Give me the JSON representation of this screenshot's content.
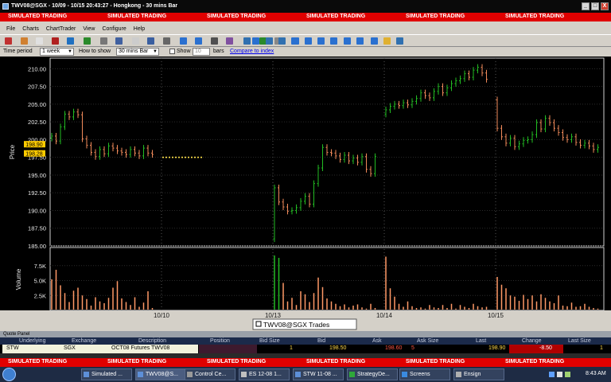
{
  "window": {
    "title": "TWV08@SGX - 10/09 - 10/15 20:43:27 - Hongkong - 30 mins Bar",
    "buttons": [
      "_",
      "□",
      "X"
    ]
  },
  "simulated_banner": "SIMULATED TRADING",
  "menu": [
    "File",
    "Charts",
    "ChartTrader",
    "View",
    "Configure",
    "Help"
  ],
  "options": {
    "time_period_label": "Time period",
    "time_period_value": "1 week",
    "how_to_show_label": "How to show",
    "how_to_show_value": "30 mins Bar",
    "show_label": "Show",
    "show_value": "10",
    "bars_label": "bars",
    "compare_link": "Compare to index"
  },
  "chart_data": {
    "type": "candlestick",
    "ylabel": "Price",
    "volume_label": "Volume",
    "price_ticks": [
      "210.00",
      "207.50",
      "205.00",
      "202.50",
      "200.00",
      "197.50",
      "195.00",
      "192.50",
      "190.00",
      "187.50",
      "185.00"
    ],
    "volume_ticks": [
      "7.5K",
      "5.0K",
      "2.5K"
    ],
    "x_ticks": [
      "10/10",
      "10/13",
      "10/14",
      "10/15"
    ],
    "price_tags": [
      "198.90",
      "198.28"
    ],
    "legend": "TWV08@SGX Trades",
    "ylim": [
      185,
      211.5
    ],
    "volume_max": 10000,
    "colors": {
      "up": "#22bb22",
      "down": "#f08a5a",
      "volume": "#ff9966"
    },
    "sessions": [
      {
        "start": 200.2,
        "points": [
          200.5,
          199.8,
          201.8,
          203.6,
          203.2,
          203.9,
          203.5,
          200.1,
          199.2,
          198.2,
          197.6,
          198.6,
          198.0,
          199.1,
          198.8,
          198.4,
          198.2,
          197.9,
          198.6,
          198.1,
          197.7,
          198.8,
          198.1,
          197.9
        ],
        "volumes": [
          5200,
          6800,
          4200,
          2900,
          1400,
          3300,
          3800,
          2500,
          1900,
          800,
          2200,
          1500,
          1200,
          2100,
          3800,
          4900,
          2000,
          1400,
          900,
          2200,
          600,
          1300,
          3200,
          400
        ]
      },
      {
        "start": 186.0,
        "points": [
          193.2,
          191.2,
          190.5,
          189.9,
          190.0,
          190.4,
          191.3,
          192.0,
          190.9,
          193.8,
          196.0,
          198.9,
          198.2,
          198.1,
          197.7,
          197.2,
          197.8,
          197.0,
          197.4,
          196.8,
          197.6,
          195.8,
          195.2,
          197.6
        ],
        "volumes": [
          9200,
          8800,
          4600,
          1500,
          2100,
          900,
          3200,
          2700,
          1400,
          2900,
          5500,
          3900,
          2000,
          1500,
          1100,
          700,
          1000,
          500,
          800,
          1000,
          500,
          300,
          1100,
          400
        ]
      },
      {
        "start": 203.6,
        "points": [
          204.2,
          204.7,
          205.0,
          204.8,
          205.2,
          204.9,
          205.4,
          205.8,
          206.6,
          206.2,
          205.9,
          206.8,
          207.5,
          206.6,
          207.3,
          207.9,
          208.3,
          208.6,
          209.3,
          208.8,
          209.8,
          210.2,
          209.4,
          208.5
        ],
        "volumes": [
          9000,
          3700,
          2300,
          1100,
          600,
          1500,
          700,
          400,
          500,
          300,
          900,
          500,
          400,
          900,
          400,
          1100,
          300,
          900,
          600,
          400,
          1100,
          700,
          500,
          600
        ]
      },
      {
        "start": 205.6,
        "points": [
          201.6,
          200.4,
          199.5,
          200.2,
          199.0,
          199.4,
          199.9,
          200.0,
          200.7,
          202.4,
          201.5,
          203.0,
          202.4,
          201.6,
          201.0,
          200.3,
          200.0,
          200.4,
          199.6,
          199.2,
          199.5,
          199.1,
          198.6,
          198.9
        ],
        "volumes": [
          5600,
          4300,
          3700,
          2500,
          2300,
          1600,
          2600,
          1900,
          2500,
          1500,
          2700,
          2100,
          1500,
          1200,
          2500,
          800,
          700,
          1300,
          600,
          700,
          1100,
          600,
          400,
          300
        ]
      }
    ],
    "dotted_close": 197.5
  },
  "quote_panel": {
    "title": "Quote Panel",
    "headers": [
      "Underlying",
      "Exchange",
      "Description",
      "Position",
      "Bid Size",
      "Bid",
      "Ask",
      "Ask Size",
      "Last",
      "Change",
      "Last Size"
    ],
    "row": {
      "underlying": "STW",
      "exchange": "SGX",
      "description": "OCT08 Futures TWV08",
      "position": "",
      "bid_size": "1",
      "bid": "198.50",
      "ask": "198.60",
      "ask_size": "5",
      "last": "198.90",
      "change": "-8.50",
      "last_size": "1"
    }
  },
  "taskbar": {
    "tasks": [
      "Simulated ...",
      "TWV08@S...",
      "Control Ce...",
      "ES 12-08 1...",
      "STW 11-08 ...",
      "StrategyDe...",
      "Screens",
      "Ensign"
    ],
    "time": "8:43 AM"
  }
}
